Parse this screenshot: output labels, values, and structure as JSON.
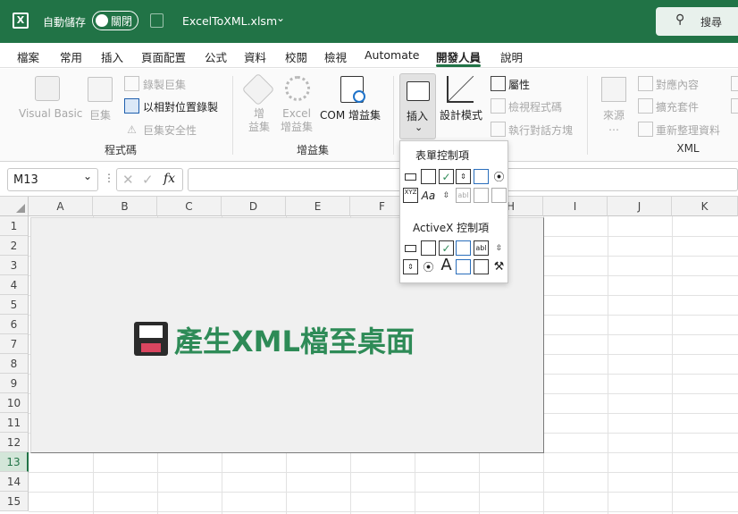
{
  "title_bar": {
    "autosave_label": "自動儲存",
    "autosave_state": "關閉",
    "filename": "ExcelToXML.xlsm",
    "search_label": "搜尋",
    "brand_color": "#217346"
  },
  "menu": {
    "items": [
      "檔案",
      "常用",
      "插入",
      "頁面配置",
      "公式",
      "資料",
      "校閱",
      "檢視",
      "Automate",
      "開發人員",
      "說明"
    ],
    "active": "開發人員"
  },
  "ribbon": {
    "code_group": {
      "label": "程式碼",
      "visual_basic": "Visual Basic",
      "macros": "巨集",
      "record_macro": "錄製巨集",
      "relative_ref": "以相對位置錄製",
      "macro_security": "巨集安全性"
    },
    "addins_group": {
      "label": "增益集",
      "addins": "增\n益集",
      "excel_addins": "Excel\n增益集",
      "com_addins": "COM 增益集"
    },
    "controls_group": {
      "insert": "插入",
      "design_mode": "設計模式",
      "properties": "屬性",
      "view_code": "檢視程式碼",
      "run_dialog": "執行對話方塊"
    },
    "xml_group": {
      "label": "XML",
      "source": "來源",
      "map_properties": "對應內容",
      "expansion_packs": "擴充套件",
      "refresh_data": "重新整理資料"
    }
  },
  "insert_dropdown": {
    "form_controls_title": "表單控制項",
    "activex_title": "ActiveX 控制項"
  },
  "formula_bar": {
    "name_box": "M13",
    "fx_label": "fx",
    "formula": ""
  },
  "sheet": {
    "columns": [
      "A",
      "B",
      "C",
      "D",
      "E",
      "F",
      "G",
      "H",
      "I",
      "J",
      "K"
    ],
    "rows": [
      "1",
      "2",
      "3",
      "4",
      "5",
      "6",
      "7",
      "8",
      "9",
      "10",
      "11",
      "12",
      "13",
      "14",
      "15"
    ],
    "button_text": "產生XML檔至桌面",
    "button_text_color": "#2e8b57"
  }
}
